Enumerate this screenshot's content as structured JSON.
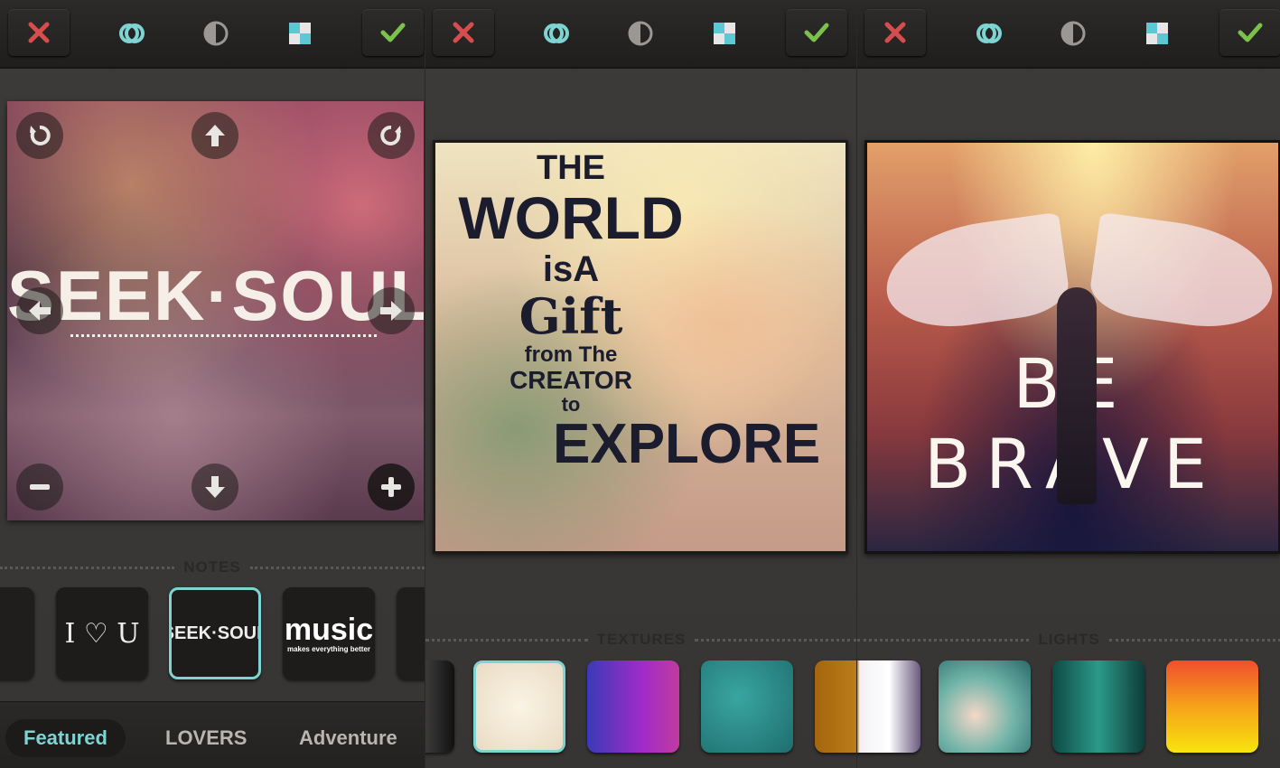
{
  "panels": [
    {
      "section_label": "NOTES",
      "overlay_text": "SEEK·SOUL",
      "notes_items": [
        "I ♡ U",
        "SEEK·SOUL",
        "music",
        "makes everything better"
      ],
      "tabs": [
        "Featured",
        "LOVERS",
        "Adventure"
      ],
      "active_tab": "Featured"
    },
    {
      "section_label": "TEXTURES",
      "overlay_lines": [
        "THE",
        "WORLD",
        "isA",
        "Gift",
        "from The",
        "CREATOR",
        "to",
        "EXPLORE"
      ]
    },
    {
      "section_label": "LIGHTS",
      "overlay_text": "BE BRAVE"
    }
  ],
  "toolbar_icons": [
    "close-icon",
    "blend-icon",
    "contrast-icon",
    "checker-icon",
    "check-icon"
  ],
  "colors": {
    "accent_teal": "#7ed4d2",
    "close_red": "#d64d4d",
    "check_green": "#7cc24a"
  }
}
